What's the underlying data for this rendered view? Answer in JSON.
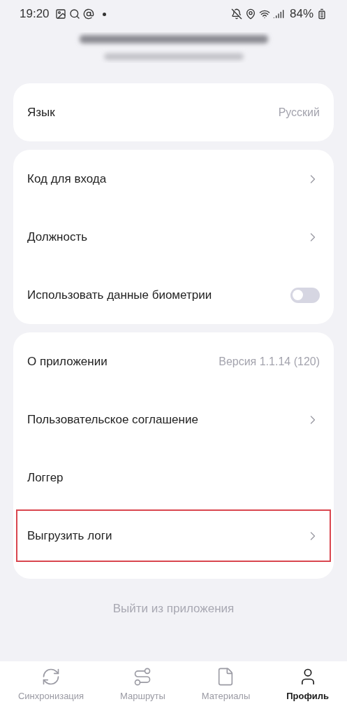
{
  "status_bar": {
    "time": "19:20",
    "battery": "84%"
  },
  "sections": [
    {
      "rows": [
        {
          "kind": "value",
          "label": "Язык",
          "value": "Русский",
          "highlighted": false
        }
      ]
    },
    {
      "rows": [
        {
          "kind": "chevron",
          "label": "Код для входа",
          "highlighted": false
        },
        {
          "kind": "chevron",
          "label": "Должность",
          "highlighted": false
        },
        {
          "kind": "toggle",
          "label": "Использовать данные биометрии",
          "on": false,
          "highlighted": false
        }
      ]
    },
    {
      "rows": [
        {
          "kind": "value",
          "label": "О приложении",
          "value": "Версия 1.1.14 (120)",
          "highlighted": false
        },
        {
          "kind": "chevron",
          "label": "Пользовательское соглашение",
          "highlighted": false
        },
        {
          "kind": "plain",
          "label": "Логгер",
          "highlighted": false
        },
        {
          "kind": "chevron",
          "label": "Выгрузить логи",
          "highlighted": true
        }
      ]
    }
  ],
  "logout": "Выйти из приложения",
  "tab_bar": [
    {
      "kind": "sync",
      "label": "Синхронизация",
      "selected": false
    },
    {
      "kind": "route",
      "label": "Маршруты",
      "selected": false
    },
    {
      "kind": "file",
      "label": "Материалы",
      "selected": false
    },
    {
      "kind": "user",
      "label": "Профиль",
      "selected": true
    }
  ]
}
